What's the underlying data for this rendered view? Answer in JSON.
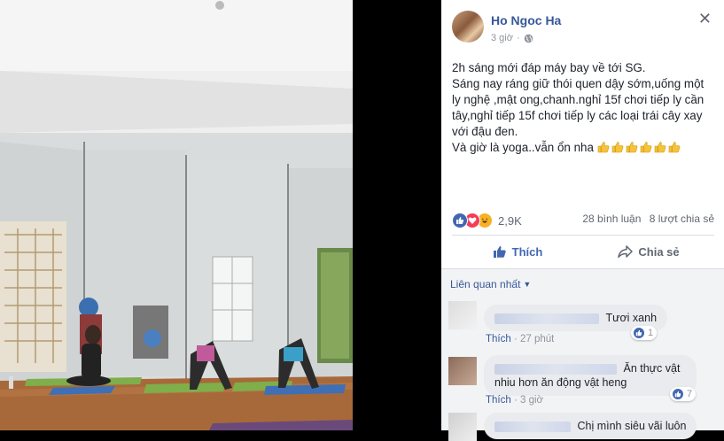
{
  "post": {
    "author": "Ho Ngoc Ha",
    "time": "3 giờ",
    "lines": [
      "2h sáng mới đáp máy bay về tới SG.",
      "Sáng nay ráng giữ thói quen dậy sớm,uống một ly nghệ ,mật ong,chanh.nghỉ 15f chơi tiếp ly cần tây,nghỉ tiếp 15f chơi tiếp ly các loại trái cây xay với đậu đen.",
      "Và giờ là yoga..vẫn ổn nha"
    ],
    "thumbs_count": 6
  },
  "stats": {
    "reactions": "2,9K",
    "comments": "28 bình luận",
    "shares": "8 lượt chia sẻ"
  },
  "actions": {
    "like": "Thích",
    "share": "Chia sẻ"
  },
  "comments": {
    "sort_label": "Liên quan nhất",
    "items": [
      {
        "text": "Tươi xanh",
        "like_label": "Thích",
        "time": "27 phút",
        "likes": "1"
      },
      {
        "text": "Ăn thực vật nhiu hơn ăn động vật heng",
        "like_label": "Thích",
        "time": "3 giờ",
        "likes": "7"
      },
      {
        "text": "Chị mình siêu vãi luôn"
      }
    ]
  },
  "colors": {
    "brand_blue": "#4267b2",
    "name_blue": "#365899",
    "mat_green": "#7fae4a"
  }
}
